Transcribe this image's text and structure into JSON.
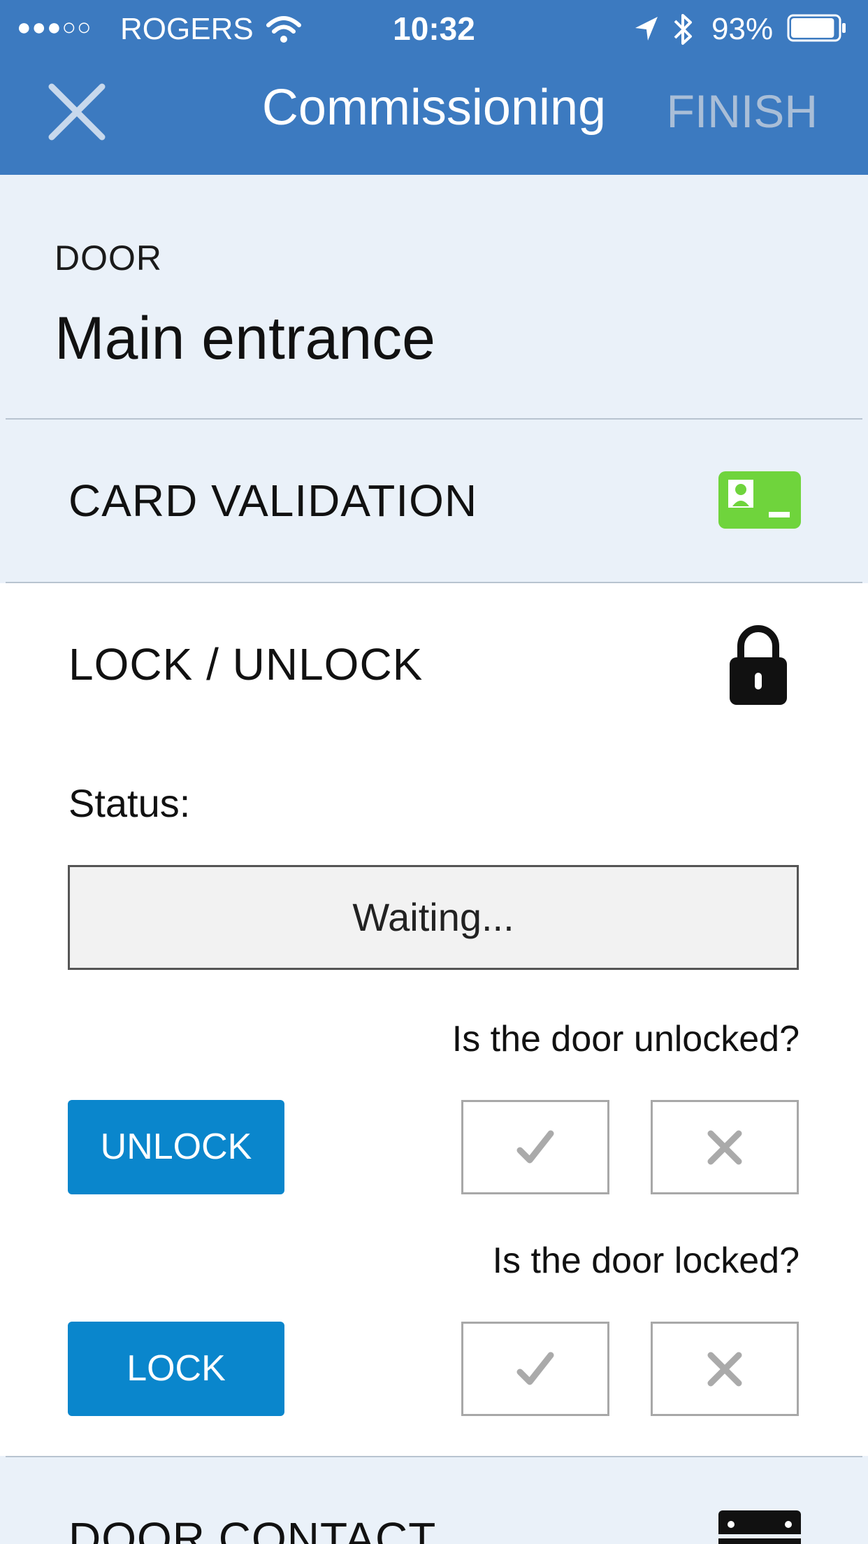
{
  "status_bar": {
    "signal_dots": "●●●○○",
    "carrier": "ROGERS",
    "time": "10:32",
    "battery_percent": "93%",
    "battery_level": 0.93,
    "icons": [
      "wifi-icon",
      "location-arrow-icon",
      "bluetooth-icon",
      "battery-icon"
    ]
  },
  "nav": {
    "title": "Commissioning",
    "finish_label": "FINISH",
    "close_icon": "close-icon"
  },
  "door": {
    "label": "DOOR",
    "name": "Main entrance"
  },
  "card_validation": {
    "title": "CARD VALIDATION",
    "icon": "id-card-icon",
    "icon_color": "#6fd43c"
  },
  "lock_unlock": {
    "title": "LOCK / UNLOCK",
    "icon": "padlock-icon",
    "status_label": "Status:",
    "status_value": "Waiting...",
    "unlock": {
      "question": "Is the door unlocked?",
      "button_label": "UNLOCK"
    },
    "lock": {
      "question": "Is the door locked?",
      "button_label": "LOCK"
    }
  },
  "door_contact": {
    "title": "DOOR CONTACT",
    "icon": "door-contact-icon"
  },
  "colors": {
    "nav_bg": "#3c7ac0",
    "section_bg": "#eaf1f9",
    "primary_button": "#0a86cc",
    "finish_disabled": "#a9bed7"
  }
}
